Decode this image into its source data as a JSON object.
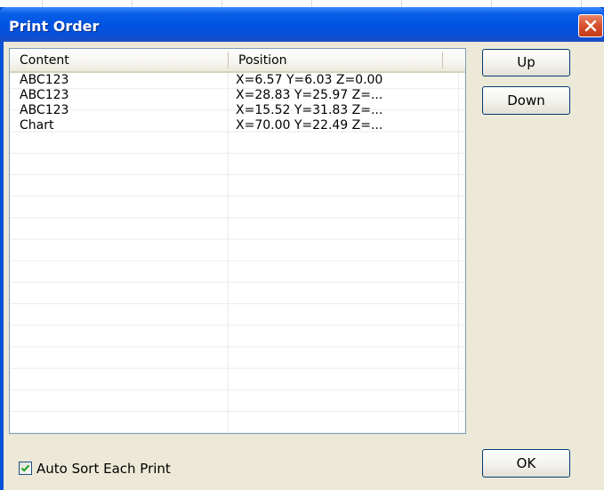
{
  "window": {
    "title": "Print Order",
    "close_icon": "close-x-icon",
    "titlebar_color": "#0054e3",
    "close_color": "#d8502c"
  },
  "list": {
    "columns": [
      {
        "label": "Content"
      },
      {
        "label": "Position"
      }
    ],
    "rows": [
      {
        "content": "ABC123",
        "position": "X=6.57 Y=6.03 Z=0.00"
      },
      {
        "content": "ABC123",
        "position": "X=28.83 Y=25.97 Z=..."
      },
      {
        "content": "ABC123",
        "position": "X=15.52 Y=31.83 Z=..."
      },
      {
        "content": "Chart",
        "position": "X=70.00 Y=22.49 Z=..."
      }
    ]
  },
  "buttons": {
    "up": "Up",
    "down": "Down",
    "ok": "OK"
  },
  "options": {
    "auto_sort_label": "Auto Sort Each Print",
    "auto_sort_checked": true,
    "check_icon": "check-mark-icon"
  }
}
